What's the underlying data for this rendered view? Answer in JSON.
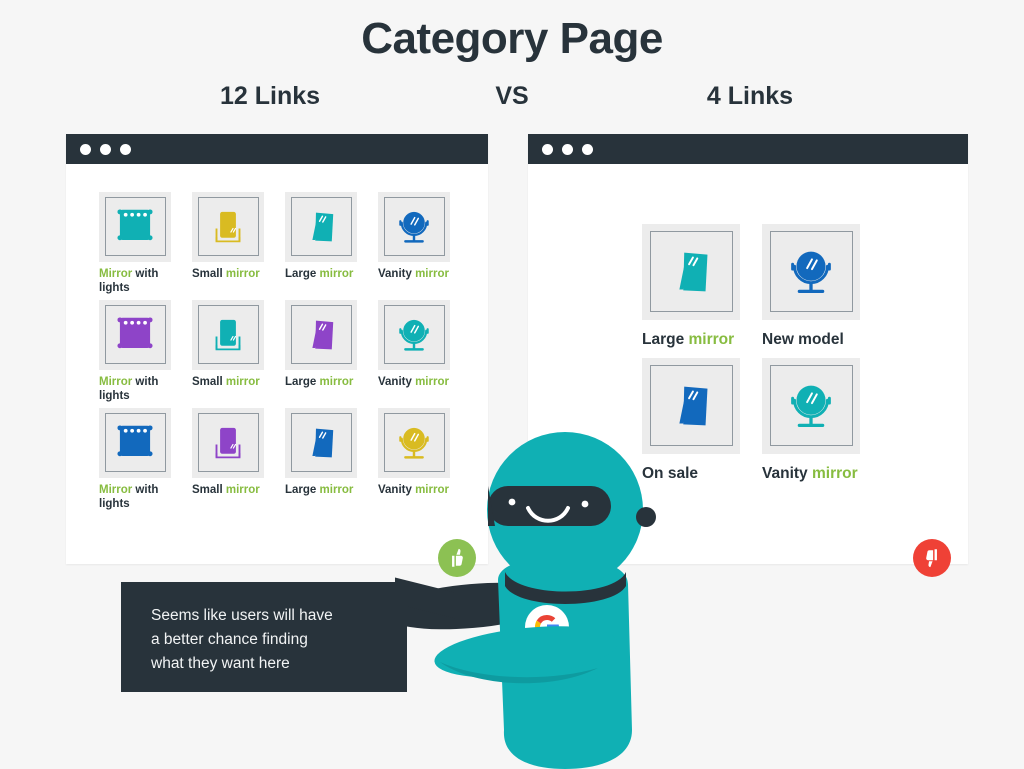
{
  "header": {
    "title": "Category Page",
    "left_label": "12 Links",
    "vs_label": "VS",
    "right_label": "4 Links"
  },
  "colors": {
    "background": "#f6f6f6",
    "ink": "#28333b",
    "green_highlight": "#87bc40",
    "teal": "#10b0b4",
    "purple": "#8e44c8",
    "blue": "#1269bd",
    "yellow": "#d9bb22",
    "thumb_up": "#8cc153",
    "thumb_down": "#ef4136",
    "tile_bg": "#ececec",
    "frame_border": "#9099a0"
  },
  "left_window": {
    "window_dots": [
      "dot",
      "dot",
      "dot"
    ],
    "verdict": "thumbs-up",
    "tiles": [
      {
        "icon": "mirror-with-lights-icon",
        "color": "#10b0b4",
        "label_green": "Mirror",
        "label_dark": "with lights"
      },
      {
        "icon": "small-mirror-icon",
        "color": "#d9bb22",
        "label_dark": "Small",
        "label_green": "mirror"
      },
      {
        "icon": "large-mirror-icon",
        "color": "#10b0b4",
        "label_dark": "Large",
        "label_green": "mirror"
      },
      {
        "icon": "vanity-mirror-icon",
        "color": "#1269bd",
        "label_dark": "Vanity",
        "label_green": "mirror"
      },
      {
        "icon": "mirror-with-lights-icon",
        "color": "#8e44c8",
        "label_green": "Mirror",
        "label_dark": "with lights"
      },
      {
        "icon": "small-mirror-icon",
        "color": "#10b0b4",
        "label_dark": "Small",
        "label_green": "mirror"
      },
      {
        "icon": "large-mirror-icon",
        "color": "#8e44c8",
        "label_dark": "Large",
        "label_green": "mirror"
      },
      {
        "icon": "vanity-mirror-icon",
        "color": "#10b0b4",
        "label_dark": "Vanity",
        "label_green": "mirror"
      },
      {
        "icon": "mirror-with-lights-icon",
        "color": "#1269bd",
        "label_green": "Mirror",
        "label_dark": "with lights"
      },
      {
        "icon": "small-mirror-icon",
        "color": "#8e44c8",
        "label_dark": "Small",
        "label_green": "mirror"
      },
      {
        "icon": "large-mirror-icon",
        "color": "#1269bd",
        "label_dark": "Large",
        "label_green": "mirror"
      },
      {
        "icon": "vanity-mirror-icon",
        "color": "#d9bb22",
        "label_dark": "Vanity",
        "label_green": "mirror"
      }
    ]
  },
  "right_window": {
    "window_dots": [
      "dot",
      "dot",
      "dot"
    ],
    "verdict": "thumbs-down",
    "tiles": [
      {
        "icon": "large-mirror-icon",
        "color": "#10b0b4",
        "label_dark": "Large",
        "label_green": "mirror"
      },
      {
        "icon": "vanity-mirror-icon",
        "color": "#1269bd",
        "label_dark": "New model",
        "label_green": ""
      },
      {
        "icon": "large-mirror-icon",
        "color": "#1269bd",
        "label_dark": "On sale",
        "label_green": ""
      },
      {
        "icon": "vanity-mirror-icon",
        "color": "#10b0b4",
        "label_dark": "Vanity",
        "label_green": "mirror"
      }
    ]
  },
  "speech_bubble": {
    "line1": "Seems like users will have",
    "line2": "a better chance finding",
    "line3": "what they want here"
  },
  "robot": {
    "name": "google-robot-mascot",
    "badge": "google-g-logo",
    "body_color": "#10b0b4",
    "mask_color": "#28333b"
  }
}
